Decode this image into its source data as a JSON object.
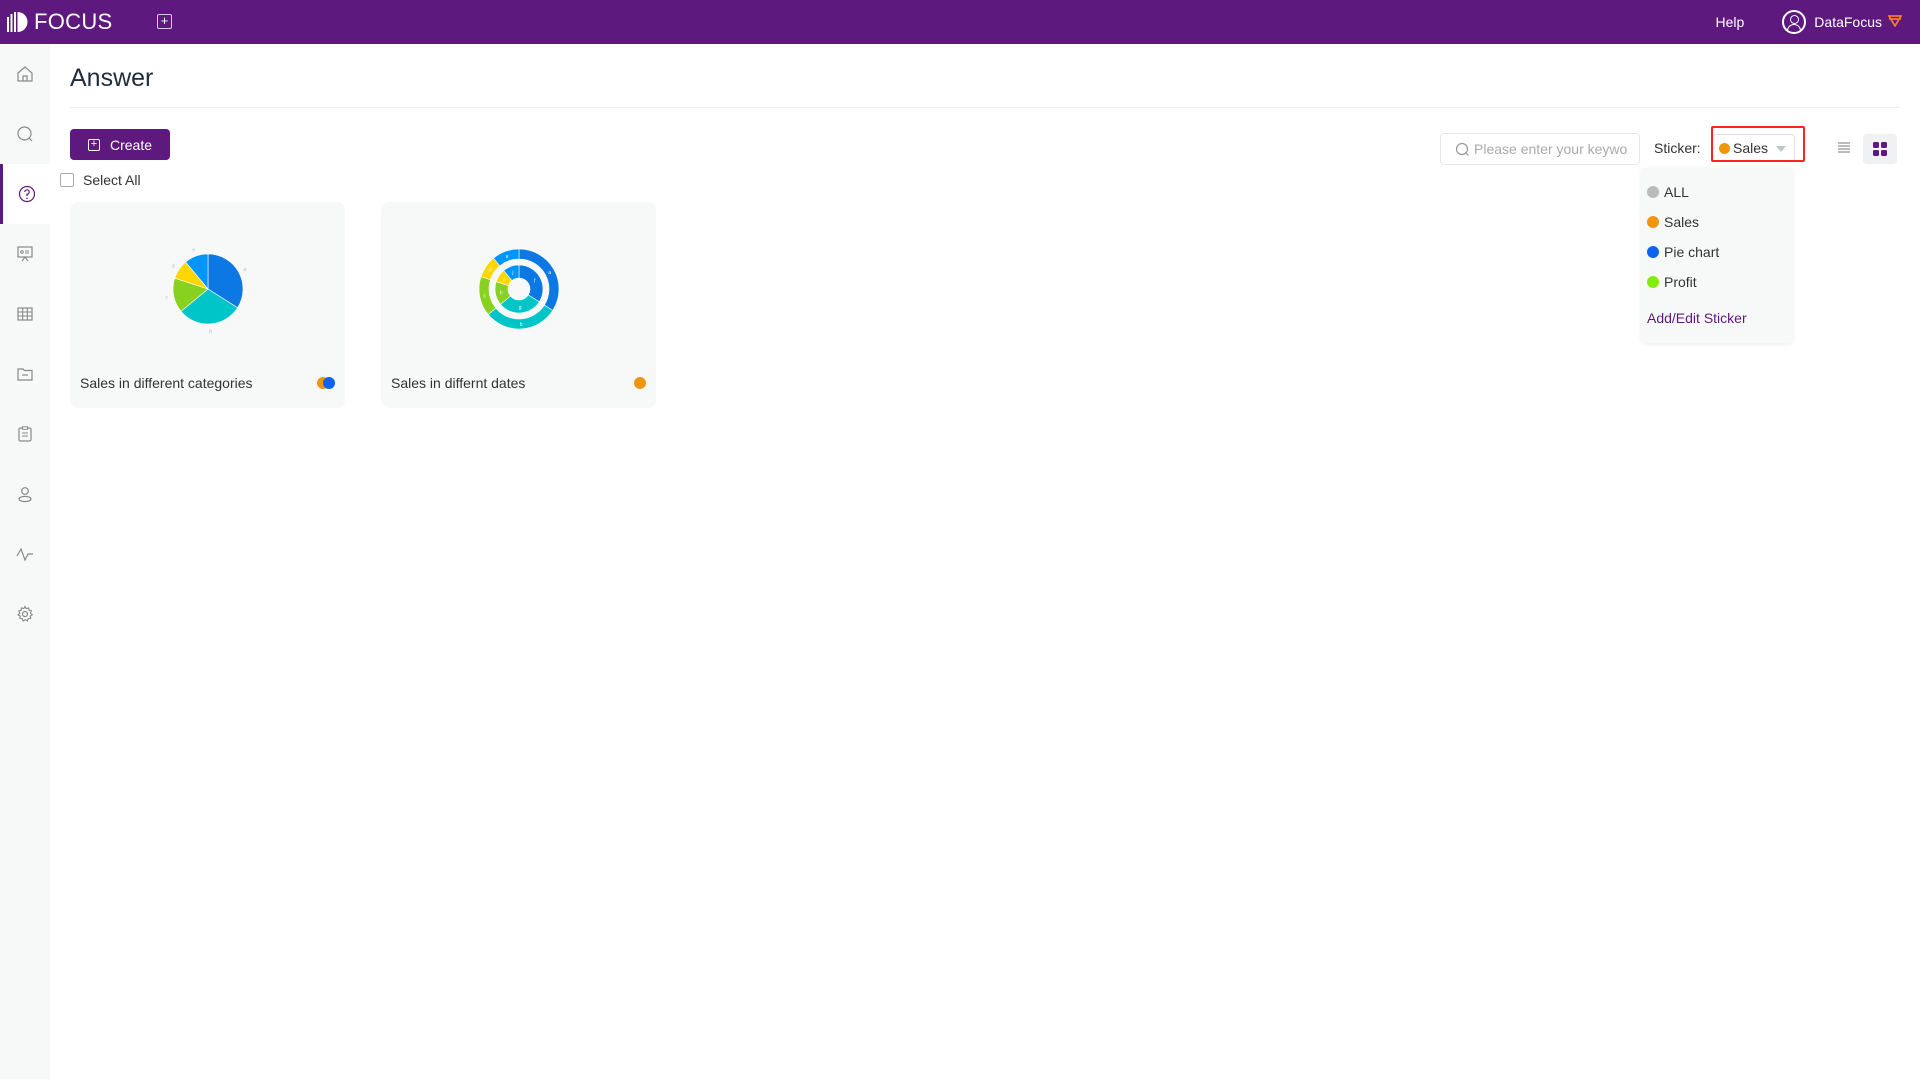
{
  "app": {
    "logo_text": "FOCUS",
    "brand_color": "#5e197e"
  },
  "topbar": {
    "add_icon": "plus-square-icon",
    "help_label": "Help",
    "user_name": "DataFocus",
    "user_icon": "user-circle-icon",
    "badge_icon": "diamond-icon"
  },
  "sidebar": {
    "items": [
      {
        "name": "home",
        "icon": "home-icon",
        "active": false
      },
      {
        "name": "search",
        "icon": "search-icon",
        "active": false
      },
      {
        "name": "answer",
        "icon": "question-circle-icon",
        "active": true
      },
      {
        "name": "presentation",
        "icon": "presentation-icon",
        "active": false
      },
      {
        "name": "data-table",
        "icon": "grid-table-icon",
        "active": false
      },
      {
        "name": "folder",
        "icon": "folder-icon",
        "active": false
      },
      {
        "name": "clipboard",
        "icon": "clipboard-icon",
        "active": false
      },
      {
        "name": "user",
        "icon": "user-icon",
        "active": false
      },
      {
        "name": "monitor",
        "icon": "pulse-icon",
        "active": false
      },
      {
        "name": "settings",
        "icon": "gear-icon",
        "active": false
      }
    ]
  },
  "page": {
    "title": "Answer",
    "create_label": "Create",
    "select_all_label": "Select All",
    "search_placeholder": "Please enter your keywo",
    "sticker_label": "Sticker:",
    "sticker_selected": "Sales",
    "sticker_selected_color": "#f0960e"
  },
  "sticker_dropdown": {
    "options": [
      {
        "label": "ALL",
        "color": "#bbbbbb"
      },
      {
        "label": "Sales",
        "color": "#f0960e"
      },
      {
        "label": "Pie chart",
        "color": "#0d62f0"
      },
      {
        "label": "Profit",
        "color": "#84ec0c"
      }
    ],
    "edit_link": "Add/Edit Sticker"
  },
  "cards": [
    {
      "title": "Sales in different categories",
      "stickers": [
        "#f0960e",
        "#0d62f0"
      ]
    },
    {
      "title": "Sales in differnt dates",
      "stickers": [
        "#f0960e"
      ]
    }
  ],
  "chart_data": [
    {
      "type": "pie",
      "title": "Sales in different categories",
      "categories": [
        "a",
        "b",
        "c",
        "d",
        "e"
      ],
      "values": [
        34,
        30,
        16,
        9,
        11
      ],
      "colors": [
        "#0b78e3",
        "#00c5c8",
        "#88d120",
        "#fed700",
        "#0095fb"
      ]
    },
    {
      "type": "pie",
      "title": "Sales in differnt dates",
      "variant": "nested-donut",
      "series": [
        {
          "name": "outer",
          "categories": [
            "a",
            "b",
            "c",
            "d",
            "e"
          ],
          "values": [
            34,
            30,
            16,
            9,
            11
          ]
        },
        {
          "name": "inner",
          "categories": [
            "f",
            "g",
            "h",
            "i",
            "j"
          ],
          "values": [
            34,
            30,
            16,
            9,
            11
          ]
        }
      ],
      "colors": [
        "#0b78e3",
        "#00c5c8",
        "#88d120",
        "#fed700",
        "#0095fb"
      ]
    }
  ]
}
